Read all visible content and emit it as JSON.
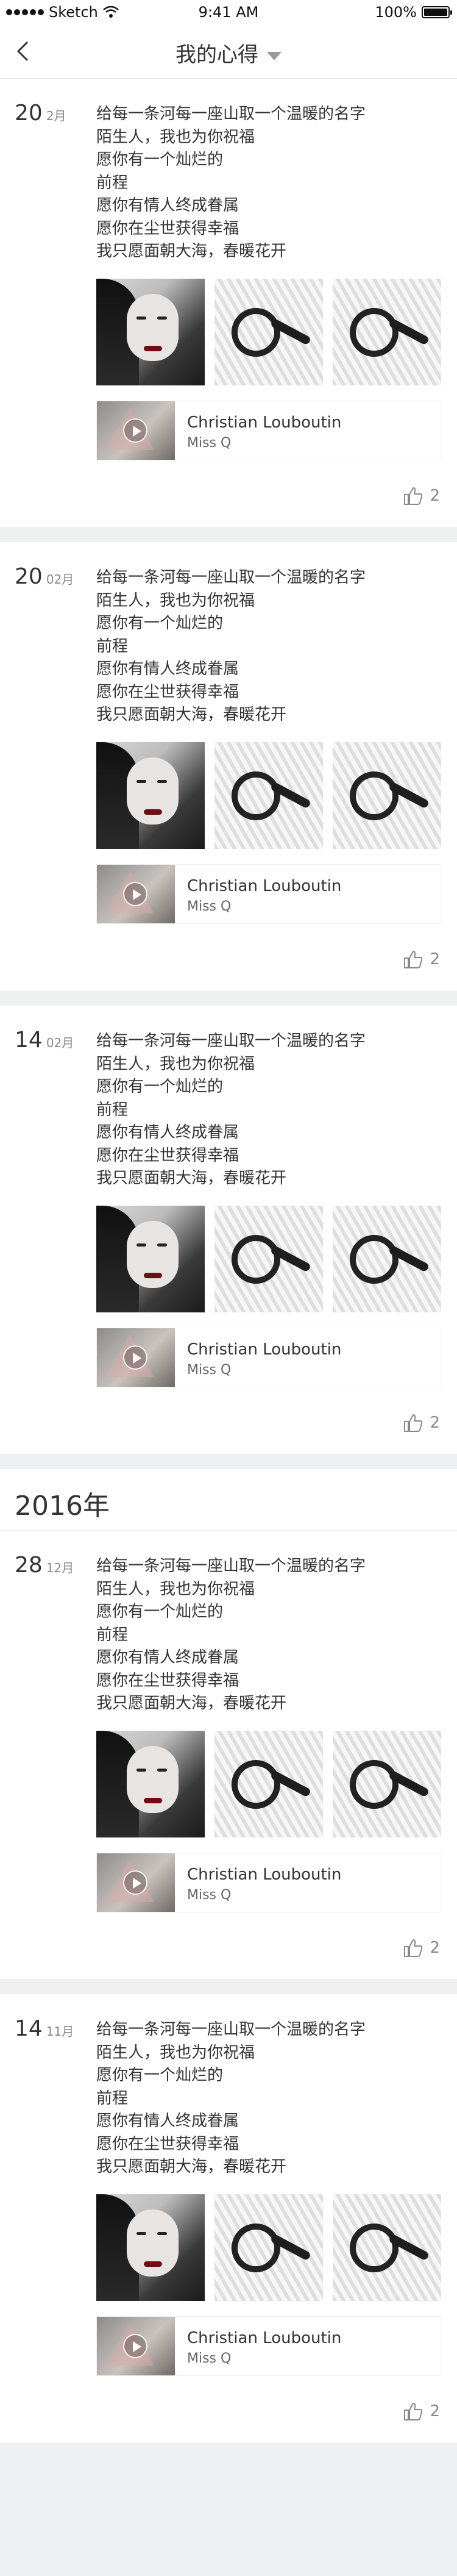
{
  "status": {
    "carrier": "Sketch",
    "time": "9:41 AM",
    "battery": "100%"
  },
  "nav": {
    "title": "我的心得"
  },
  "text_lines": [
    "给每一条河每一座山取一个温暖的名字",
    "陌生人，我也为你祝福",
    "愿你有一个灿烂的",
    "前程",
    "愿你有情人终成眷属",
    "愿你在尘世获得幸福",
    "我只愿面朝大海，春暖花开"
  ],
  "music": {
    "title": "Christian Louboutin",
    "artist": "Miss Q"
  },
  "year_header": "2016年",
  "posts": [
    {
      "day": "20",
      "month": "2月",
      "likes": "2"
    },
    {
      "day": "20",
      "month": "02月",
      "likes": "2"
    },
    {
      "day": "14",
      "month": "02月",
      "likes": "2"
    },
    {
      "day": "28",
      "month": "12月",
      "likes": "2"
    },
    {
      "day": "14",
      "month": "11月",
      "likes": "2"
    }
  ],
  "colors": {
    "background": "#eef0f1",
    "card": "#ffffff",
    "text": "#333333",
    "muted": "#888888"
  }
}
